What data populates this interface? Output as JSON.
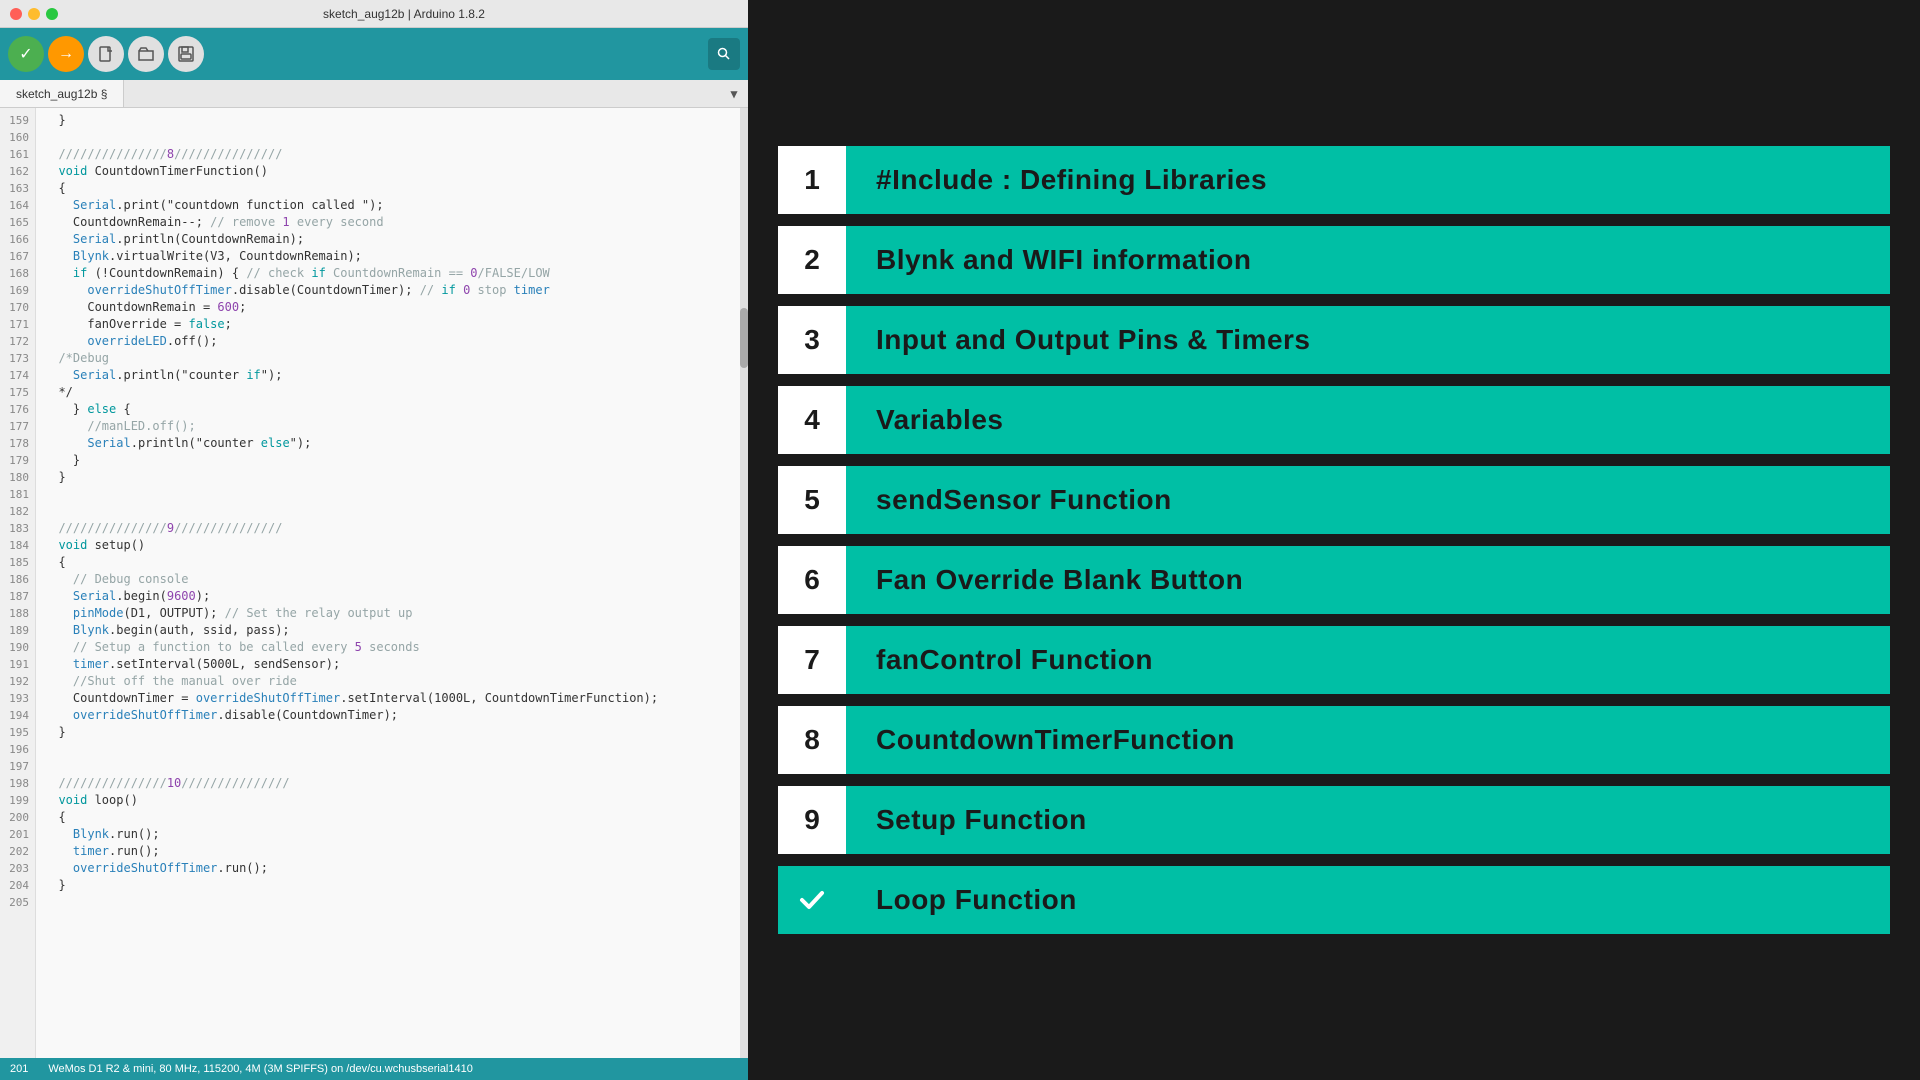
{
  "window": {
    "title": "sketch_aug12b | Arduino 1.8.2"
  },
  "toolbar": {
    "verify_label": "✓",
    "upload_label": "→",
    "new_label": "📄",
    "open_label": "↑",
    "save_label": "↓",
    "search_label": "🔍"
  },
  "tab": {
    "name": "sketch_aug12b §",
    "dropdown": "▼"
  },
  "status_bar": {
    "line": "201",
    "board": "WeMos D1 R2 & mini, 80 MHz, 115200, 4M (3M SPIFFS) on /dev/cu.wchusbserial1410"
  },
  "nav_items": [
    {
      "number": "1",
      "label": "#Include : Defining Libraries",
      "check": false
    },
    {
      "number": "2",
      "label": "Blynk and WIFI information",
      "check": false
    },
    {
      "number": "3",
      "label": "Input and Output Pins & Timers",
      "check": false
    },
    {
      "number": "4",
      "label": "Variables",
      "check": false
    },
    {
      "number": "5",
      "label": "sendSensor Function",
      "check": false
    },
    {
      "number": "6",
      "label": "Fan Override Blank Button",
      "check": false
    },
    {
      "number": "7",
      "label": "fanControl Function",
      "check": false
    },
    {
      "number": "8",
      "label": "CountdownTimerFunction",
      "check": false
    },
    {
      "number": "9",
      "label": "Setup Function",
      "check": false
    },
    {
      "number": "✓",
      "label": "Loop Function",
      "check": true
    }
  ],
  "code_lines": [
    {
      "num": "159",
      "text": "  }"
    },
    {
      "num": "160",
      "text": ""
    },
    {
      "num": "161",
      "text": "  ///////////////8///////////////"
    },
    {
      "num": "162",
      "text": "  void CountdownTimerFunction()"
    },
    {
      "num": "163",
      "text": "  {"
    },
    {
      "num": "164",
      "text": "    Serial.print(\"countdown function called \");"
    },
    {
      "num": "165",
      "text": "    CountdownRemain--; // remove 1 every second"
    },
    {
      "num": "166",
      "text": "    Serial.println(CountdownRemain);"
    },
    {
      "num": "167",
      "text": "    Blynk.virtualWrite(V3, CountdownRemain);"
    },
    {
      "num": "168",
      "text": "    if (!CountdownRemain) { // check if CountdownRemain == 0/FALSE/LOW"
    },
    {
      "num": "169",
      "text": "      overrideShutOffTimer.disable(CountdownTimer); // if 0 stop timer"
    },
    {
      "num": "170",
      "text": "      CountdownRemain = 600;"
    },
    {
      "num": "171",
      "text": "      fanOverride = false;"
    },
    {
      "num": "172",
      "text": "      overrideLED.off();"
    },
    {
      "num": "173",
      "text": "  /*Debug"
    },
    {
      "num": "174",
      "text": "    Serial.println(\"counter if\");"
    },
    {
      "num": "175",
      "text": "  */"
    },
    {
      "num": "176",
      "text": "    } else {"
    },
    {
      "num": "177",
      "text": "      //manLED.off();"
    },
    {
      "num": "178",
      "text": "      Serial.println(\"counter else\");"
    },
    {
      "num": "179",
      "text": "    }"
    },
    {
      "num": "180",
      "text": "  }"
    },
    {
      "num": "181",
      "text": ""
    },
    {
      "num": "182",
      "text": ""
    },
    {
      "num": "183",
      "text": "  ///////////////9///////////////"
    },
    {
      "num": "184",
      "text": "  void setup()"
    },
    {
      "num": "185",
      "text": "  {"
    },
    {
      "num": "186",
      "text": "    // Debug console"
    },
    {
      "num": "187",
      "text": "    Serial.begin(9600);"
    },
    {
      "num": "188",
      "text": "    pinMode(D1, OUTPUT); // Set the relay output up"
    },
    {
      "num": "189",
      "text": "    Blynk.begin(auth, ssid, pass);"
    },
    {
      "num": "190",
      "text": "    // Setup a function to be called every 5 seconds"
    },
    {
      "num": "191",
      "text": "    timer.setInterval(5000L, sendSensor);"
    },
    {
      "num": "192",
      "text": "    //Shut off the manual over ride"
    },
    {
      "num": "193",
      "text": "    CountdownTimer = overrideShutOffTimer.setInterval(1000L, CountdownTimerFunction);"
    },
    {
      "num": "194",
      "text": "    overrideShutOffTimer.disable(CountdownTimer);"
    },
    {
      "num": "195",
      "text": "  }"
    },
    {
      "num": "196",
      "text": ""
    },
    {
      "num": "197",
      "text": ""
    },
    {
      "num": "198",
      "text": "  ///////////////10///////////////"
    },
    {
      "num": "199",
      "text": "  void loop()"
    },
    {
      "num": "200",
      "text": "  {"
    },
    {
      "num": "201",
      "text": "    Blynk.run();"
    },
    {
      "num": "202",
      "text": "    timer.run();"
    },
    {
      "num": "203",
      "text": "    overrideShutOffTimer.run();"
    },
    {
      "num": "204",
      "text": "  }"
    },
    {
      "num": "205",
      "text": ""
    }
  ]
}
